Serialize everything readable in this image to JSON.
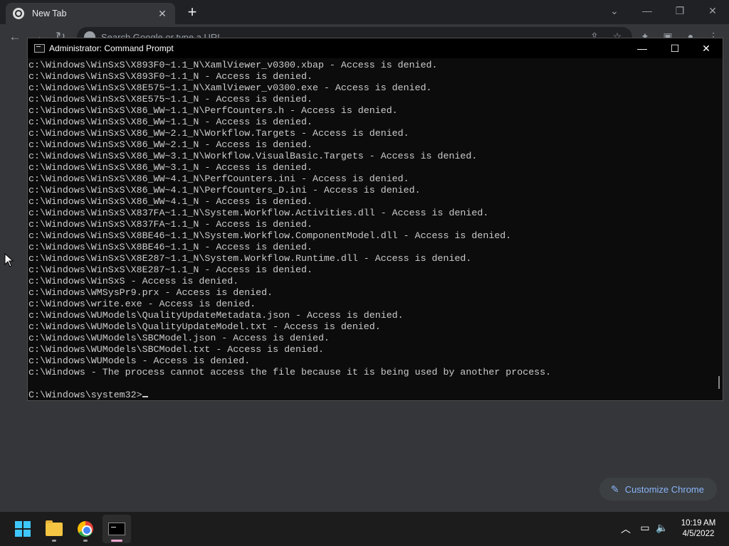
{
  "chrome": {
    "tab_title": "New Tab",
    "tab_close": "✕",
    "new_tab": "+",
    "omnibox_placeholder": "Search Google or type a URL",
    "customize_label": "Customize Chrome",
    "icons": [
      "back-icon",
      "forward-icon",
      "reload-icon",
      "share-icon",
      "star-icon",
      "extensions-icon",
      "sidepanel-icon",
      "profile-icon",
      "menu-icon"
    ]
  },
  "cmd": {
    "title": "Administrator: Command Prompt",
    "lines": [
      "c:\\Windows\\WinSxS\\X893F0~1.1_N\\XamlViewer_v0300.xbap - Access is denied.",
      "c:\\Windows\\WinSxS\\X893F0~1.1_N - Access is denied.",
      "c:\\Windows\\WinSxS\\X8E575~1.1_N\\XamlViewer_v0300.exe - Access is denied.",
      "c:\\Windows\\WinSxS\\X8E575~1.1_N - Access is denied.",
      "c:\\Windows\\WinSxS\\X86_WW~1.1_N\\PerfCounters.h - Access is denied.",
      "c:\\Windows\\WinSxS\\X86_WW~1.1_N - Access is denied.",
      "c:\\Windows\\WinSxS\\X86_WW~2.1_N\\Workflow.Targets - Access is denied.",
      "c:\\Windows\\WinSxS\\X86_WW~2.1_N - Access is denied.",
      "c:\\Windows\\WinSxS\\X86_WW~3.1_N\\Workflow.VisualBasic.Targets - Access is denied.",
      "c:\\Windows\\WinSxS\\X86_WW~3.1_N - Access is denied.",
      "c:\\Windows\\WinSxS\\X86_WW~4.1_N\\PerfCounters.ini - Access is denied.",
      "c:\\Windows\\WinSxS\\X86_WW~4.1_N\\PerfCounters_D.ini - Access is denied.",
      "c:\\Windows\\WinSxS\\X86_WW~4.1_N - Access is denied.",
      "c:\\Windows\\WinSxS\\X837FA~1.1_N\\System.Workflow.Activities.dll - Access is denied.",
      "c:\\Windows\\WinSxS\\X837FA~1.1_N - Access is denied.",
      "c:\\Windows\\WinSxS\\X8BE46~1.1_N\\System.Workflow.ComponentModel.dll - Access is denied.",
      "c:\\Windows\\WinSxS\\X8BE46~1.1_N - Access is denied.",
      "c:\\Windows\\WinSxS\\X8E287~1.1_N\\System.Workflow.Runtime.dll - Access is denied.",
      "c:\\Windows\\WinSxS\\X8E287~1.1_N - Access is denied.",
      "c:\\Windows\\WinSxS - Access is denied.",
      "c:\\Windows\\WMSysPr9.prx - Access is denied.",
      "c:\\Windows\\write.exe - Access is denied.",
      "c:\\Windows\\WUModels\\QualityUpdateMetadata.json - Access is denied.",
      "c:\\Windows\\WUModels\\QualityUpdateModel.txt - Access is denied.",
      "c:\\Windows\\WUModels\\SBCModel.json - Access is denied.",
      "c:\\Windows\\WUModels\\SBCModel.txt - Access is denied.",
      "c:\\Windows\\WUModels - Access is denied.",
      "c:\\Windows - The process cannot access the file because it is being used by another process."
    ],
    "prompt": "C:\\Windows\\system32>"
  },
  "taskbar": {
    "apps": [
      "start-icon",
      "file-explorer-icon",
      "chrome-icon",
      "terminal-icon"
    ],
    "time": "10:19 AM",
    "date": "4/5/2022"
  }
}
